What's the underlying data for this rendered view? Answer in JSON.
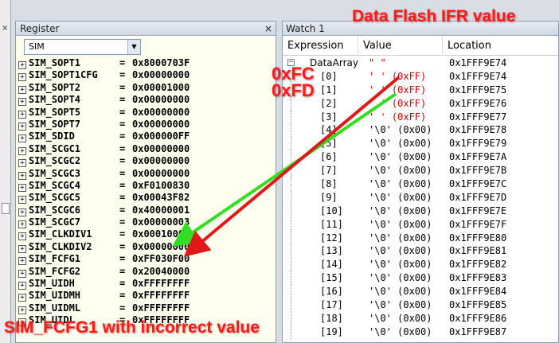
{
  "register_panel": {
    "title": "Register",
    "close_glyph": "×",
    "selector_value": "SIM",
    "expand_glyph": "+",
    "rows": [
      {
        "name": "SIM_SOPT1",
        "value": "0x8000703F"
      },
      {
        "name": "SIM_SOPT1CFG",
        "value": "0x00000000"
      },
      {
        "name": "SIM_SOPT2",
        "value": "0x00001000"
      },
      {
        "name": "SIM_SOPT4",
        "value": "0x00000000"
      },
      {
        "name": "SIM_SOPT5",
        "value": "0x00000000"
      },
      {
        "name": "SIM_SOPT7",
        "value": "0x00000000"
      },
      {
        "name": "SIM_SDID",
        "value": "0x000000FF"
      },
      {
        "name": "SIM_SCGC1",
        "value": "0x00000000"
      },
      {
        "name": "SIM_SCGC2",
        "value": "0x00000000"
      },
      {
        "name": "SIM_SCGC3",
        "value": "0x00000000"
      },
      {
        "name": "SIM_SCGC4",
        "value": "0xF0100830"
      },
      {
        "name": "SIM_SCGC5",
        "value": "0x00043F82"
      },
      {
        "name": "SIM_SCGC6",
        "value": "0x40000001"
      },
      {
        "name": "SIM_SCGC7",
        "value": "0x00000003"
      },
      {
        "name": "SIM_CLKDIV1",
        "value": "0x00010000"
      },
      {
        "name": "SIM_CLKDIV2",
        "value": "0x00000000"
      },
      {
        "name": "SIM_FCFG1",
        "value": "0xFF030F00"
      },
      {
        "name": "SIM_FCFG2",
        "value": "0x20040000"
      },
      {
        "name": "SIM_UIDH",
        "value": "0xFFFFFFFF"
      },
      {
        "name": "SIM_UIDMH",
        "value": "0xFFFFFFFF"
      },
      {
        "name": "SIM_UIDML",
        "value": "0xFFFFFFFF"
      },
      {
        "name": "SIM_UIDL",
        "value": "0xFFFFFFFF"
      }
    ]
  },
  "watch_panel": {
    "title": "Watch 1",
    "columns": [
      "Expression",
      "Value",
      "Location"
    ],
    "root": {
      "expression": "DataArray",
      "value": "\"          \"",
      "location": "0x1FFF9E74",
      "collapse_glyph": "−"
    },
    "rows": [
      {
        "index": "[0]",
        "value": "'  ' (0xFF)",
        "location": "0x1FFF9E74",
        "highlight": true
      },
      {
        "index": "[1]",
        "value": "'  ' (0xFF)",
        "location": "0x1FFF9E75",
        "highlight": true
      },
      {
        "index": "[2]",
        "value": "'  ' (0xFF)",
        "location": "0x1FFF9E76",
        "highlight": true
      },
      {
        "index": "[3]",
        "value": "'  ' (0xFF)",
        "location": "0x1FFF9E77",
        "highlight": true
      },
      {
        "index": "[4]",
        "value": "'\\0' (0x00)",
        "location": "0x1FFF9E78",
        "highlight": false
      },
      {
        "index": "[5]",
        "value": "'\\0' (0x00)",
        "location": "0x1FFF9E79",
        "highlight": false
      },
      {
        "index": "[6]",
        "value": "'\\0' (0x00)",
        "location": "0x1FFF9E7A",
        "highlight": false
      },
      {
        "index": "[7]",
        "value": "'\\0' (0x00)",
        "location": "0x1FFF9E7B",
        "highlight": false
      },
      {
        "index": "[8]",
        "value": "'\\0' (0x00)",
        "location": "0x1FFF9E7C",
        "highlight": false
      },
      {
        "index": "[9]",
        "value": "'\\0' (0x00)",
        "location": "0x1FFF9E7D",
        "highlight": false
      },
      {
        "index": "[10]",
        "value": "'\\0' (0x00)",
        "location": "0x1FFF9E7E",
        "highlight": false
      },
      {
        "index": "[11]",
        "value": "'\\0' (0x00)",
        "location": "0x1FFF9E7F",
        "highlight": false
      },
      {
        "index": "[12]",
        "value": "'\\0' (0x00)",
        "location": "0x1FFF9E80",
        "highlight": false
      },
      {
        "index": "[13]",
        "value": "'\\0' (0x00)",
        "location": "0x1FFF9E81",
        "highlight": false
      },
      {
        "index": "[14]",
        "value": "'\\0' (0x00)",
        "location": "0x1FFF9E82",
        "highlight": false
      },
      {
        "index": "[15]",
        "value": "'\\0' (0x00)",
        "location": "0x1FFF9E83",
        "highlight": false
      },
      {
        "index": "[16]",
        "value": "'\\0' (0x00)",
        "location": "0x1FFF9E84",
        "highlight": false
      },
      {
        "index": "[17]",
        "value": "'\\0' (0x00)",
        "location": "0x1FFF9E85",
        "highlight": false
      },
      {
        "index": "[18]",
        "value": "'\\0' (0x00)",
        "location": "0x1FFF9E86",
        "highlight": false
      },
      {
        "index": "[19]",
        "value": "'\\0' (0x00)",
        "location": "0x1FFF9E87",
        "highlight": false
      }
    ]
  },
  "annotations": {
    "title": "Data Flash IFR value",
    "label_fc": "0xFC",
    "label_fd": "0xFD",
    "bottom_caption": "SIM_FCFG1 with incorrect value",
    "arrow_red": "#e01818",
    "arrow_green": "#33dd22"
  },
  "colors": {
    "register_bg": "#fffff0",
    "value_red": "#d40000",
    "annotation_red": "#ff1a1a"
  }
}
